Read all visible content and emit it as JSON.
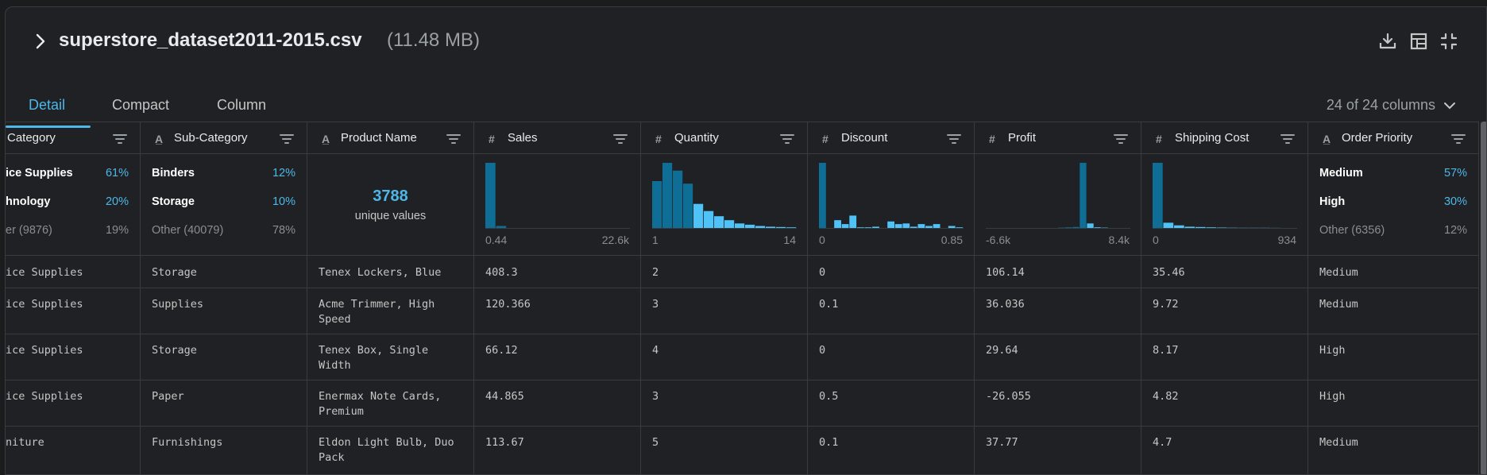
{
  "file": {
    "title": "superstore_dataset2011-2015.csv",
    "size": "(11.48 MB)"
  },
  "toolbar": {
    "download_icon": "download-icon",
    "table_icon": "table-icon",
    "collapse_icon": "collapse-icon"
  },
  "tabs": [
    {
      "label": "Detail",
      "active": true
    },
    {
      "label": "Compact",
      "active": false
    },
    {
      "label": "Column",
      "active": false
    }
  ],
  "columns_count": "24 of 24 columns",
  "colors": {
    "accent": "#4db8e8",
    "bar_dark": "#0e6e96",
    "bar_light": "#4fc3f7"
  },
  "columns": [
    {
      "name": "Category",
      "type": "string",
      "top": [
        {
          "label": "ice Supplies",
          "pct": "61%"
        },
        {
          "label": "hnology",
          "pct": "20%"
        }
      ],
      "other": {
        "label": "er (9876)",
        "pct": "19%"
      },
      "cells": [
        "ice Supplies",
        "ice Supplies",
        "ice Supplies",
        "ice Supplies",
        "niture"
      ]
    },
    {
      "name": "Sub-Category",
      "type": "string",
      "top": [
        {
          "label": "Binders",
          "pct": "12%"
        },
        {
          "label": "Storage",
          "pct": "10%"
        }
      ],
      "other": {
        "label": "Other (40079)",
        "pct": "78%"
      },
      "cells": [
        "Storage",
        "Supplies",
        "Storage",
        "Paper",
        "Furnishings"
      ]
    },
    {
      "name": "Product Name",
      "type": "string",
      "unique": {
        "count": "3788",
        "label": "unique values"
      },
      "cells": [
        "Tenex Lockers, Blue",
        "Acme Trimmer, High Speed",
        "Tenex Box, Single Width",
        "Enermax Note Cards, Premium",
        "Eldon Light Bulb, Duo Pack"
      ]
    },
    {
      "name": "Sales",
      "type": "number",
      "min": "0.44",
      "max": "22.6k",
      "hist": [
        1.0,
        0.03
      ],
      "highlight": [],
      "cells": [
        "408.3",
        "120.366",
        "66.12",
        "44.865",
        "113.67"
      ]
    },
    {
      "name": "Quantity",
      "type": "number",
      "min": "1",
      "max": "14",
      "hist": [
        0.72,
        1.0,
        0.88,
        0.68,
        0.37,
        0.26,
        0.18,
        0.12,
        0.07,
        0.05,
        0.03,
        0.02,
        0.015,
        0.01
      ],
      "highlight": [
        4,
        5,
        6,
        7,
        8,
        9,
        10,
        11,
        12,
        13
      ],
      "cells": [
        "2",
        "3",
        "4",
        "3",
        "5"
      ]
    },
    {
      "name": "Discount",
      "type": "number",
      "min": "0",
      "max": "0.85",
      "hist": [
        1.0,
        0,
        0.12,
        0.06,
        0.19,
        0.01,
        0.01,
        0.02,
        0,
        0.1,
        0.06,
        0.07,
        0.02,
        0.06,
        0.03,
        0.06,
        0,
        0.03,
        0.01
      ],
      "highlight": [
        1,
        2,
        3,
        4,
        5,
        6,
        7,
        8,
        9,
        10,
        11,
        12,
        13,
        14,
        15,
        16,
        17,
        18
      ],
      "cells": [
        "0",
        "0.1",
        "0",
        "0.5",
        "0.1"
      ]
    },
    {
      "name": "Profit",
      "type": "number",
      "min": "-6.6k",
      "max": "8.4k",
      "hist": [
        0,
        0,
        0,
        0,
        0,
        0,
        0,
        0,
        0,
        0,
        0.005,
        0.01,
        0.015,
        1.0,
        0.07,
        0.01,
        0.005,
        0,
        0,
        0
      ],
      "highlight": [
        14,
        15,
        16,
        17,
        18,
        19
      ],
      "cells": [
        "106.14",
        "36.036",
        "29.64",
        "-26.055",
        "37.77"
      ]
    },
    {
      "name": "Shipping Cost",
      "type": "number",
      "min": "0",
      "max": "934",
      "hist": [
        1.0,
        0.08,
        0.04,
        0.02,
        0.015,
        0.01,
        0.006,
        0.004,
        0.003,
        0.002,
        0.002,
        0.001
      ],
      "highlight": [
        1,
        2,
        3,
        4,
        5,
        6,
        7,
        8,
        9,
        10,
        11
      ],
      "cells": [
        "35.46",
        "9.72",
        "8.17",
        "4.82",
        "4.7"
      ]
    },
    {
      "name": "Order Priority",
      "type": "string",
      "top": [
        {
          "label": "Medium",
          "pct": "57%"
        },
        {
          "label": "High",
          "pct": "30%"
        }
      ],
      "other": {
        "label": "Other (6356)",
        "pct": "12%"
      },
      "cells": [
        "Medium",
        "Medium",
        "High",
        "High",
        "Medium"
      ]
    }
  ]
}
